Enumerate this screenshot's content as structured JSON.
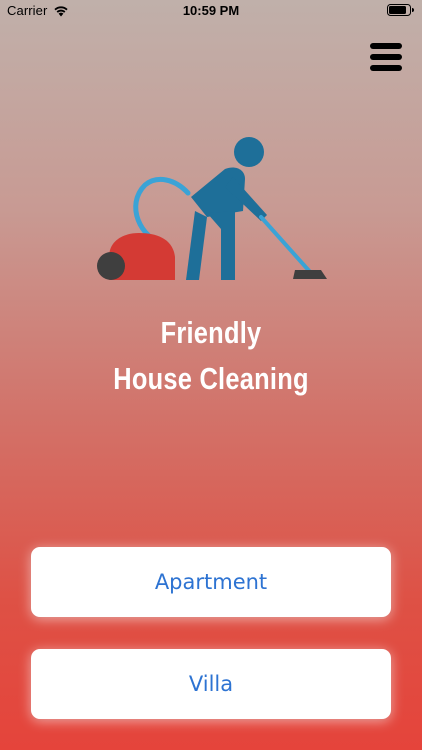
{
  "status_bar": {
    "carrier": "Carrier",
    "time": "10:59 PM"
  },
  "header": {
    "menu_icon": "hamburger-menu-icon"
  },
  "hero": {
    "illustration": "person-vacuuming-icon",
    "colors": {
      "figure": "#1e6f99",
      "hose": "#3aa3d6",
      "vacuum_body": "#d43a34",
      "wheel": "#3f3f3f"
    }
  },
  "title": {
    "line1": "Friendly",
    "line2": "House Cleaning"
  },
  "options": [
    {
      "label": "Apartment"
    },
    {
      "label": "Villa"
    }
  ],
  "colors": {
    "gradient_top": "#c0b0aa",
    "gradient_bottom": "#e5443b",
    "button_text": "#2d73d2",
    "button_bg": "#ffffff",
    "title_text": "#ffffff"
  }
}
